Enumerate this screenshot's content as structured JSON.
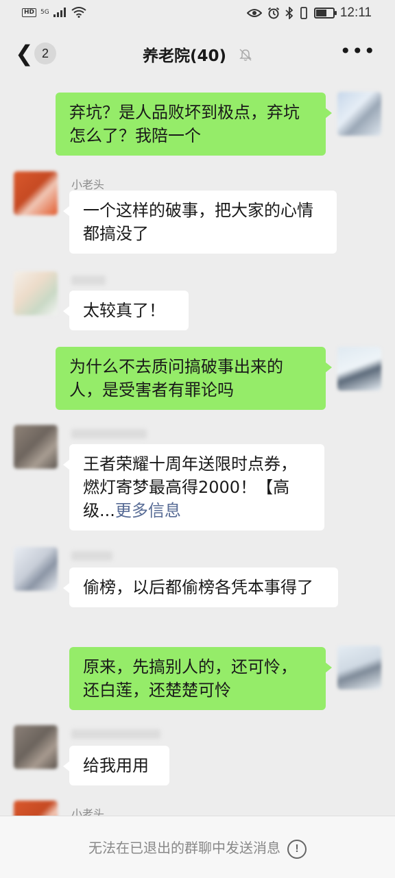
{
  "status_bar": {
    "hd": "HD",
    "signal": "5G",
    "time": "12:11",
    "battery_level": 0.7
  },
  "header": {
    "back_icon": "chevron-left-icon",
    "unread_count": "2",
    "title": "养老院(40)",
    "mute_icon": "bell-off-icon",
    "more_icon": "more-icon"
  },
  "messages": [
    {
      "side": "right",
      "sender": "",
      "text": "弃坑？是人品败坏到极点，弃坑怎么了？我陪一个"
    },
    {
      "side": "left",
      "sender": "小老头",
      "text": "一个这样的破事，把大家的心情都搞没了"
    },
    {
      "side": "left",
      "sender": "",
      "text": "太较真了！"
    },
    {
      "side": "right",
      "sender": "",
      "text": "为什么不去质问搞破事出来的人，是受害者有罪论吗"
    },
    {
      "side": "left",
      "sender": "",
      "text": "王者荣耀十周年送限时点券，燃灯寄梦最高得2000！【高级...",
      "link": "更多信息"
    },
    {
      "side": "left",
      "sender": "",
      "text": "偷榜，以后都偷榜各凭本事得了"
    },
    {
      "side": "right",
      "sender": "",
      "text": "原来，先搞别人的，还可怜，还白莲，还楚楚可怜"
    },
    {
      "side": "left",
      "sender": "",
      "text": "给我用用"
    },
    {
      "side": "left",
      "sender": "小老头",
      "text": ""
    }
  ],
  "bottom_bar": {
    "notice": "无法在已退出的群聊中发送消息",
    "icon": "exclamation-circle-icon"
  },
  "colors": {
    "background": "#ededed",
    "bubble_self": "#95ec69",
    "bubble_other": "#ffffff",
    "link": "#576b95"
  }
}
